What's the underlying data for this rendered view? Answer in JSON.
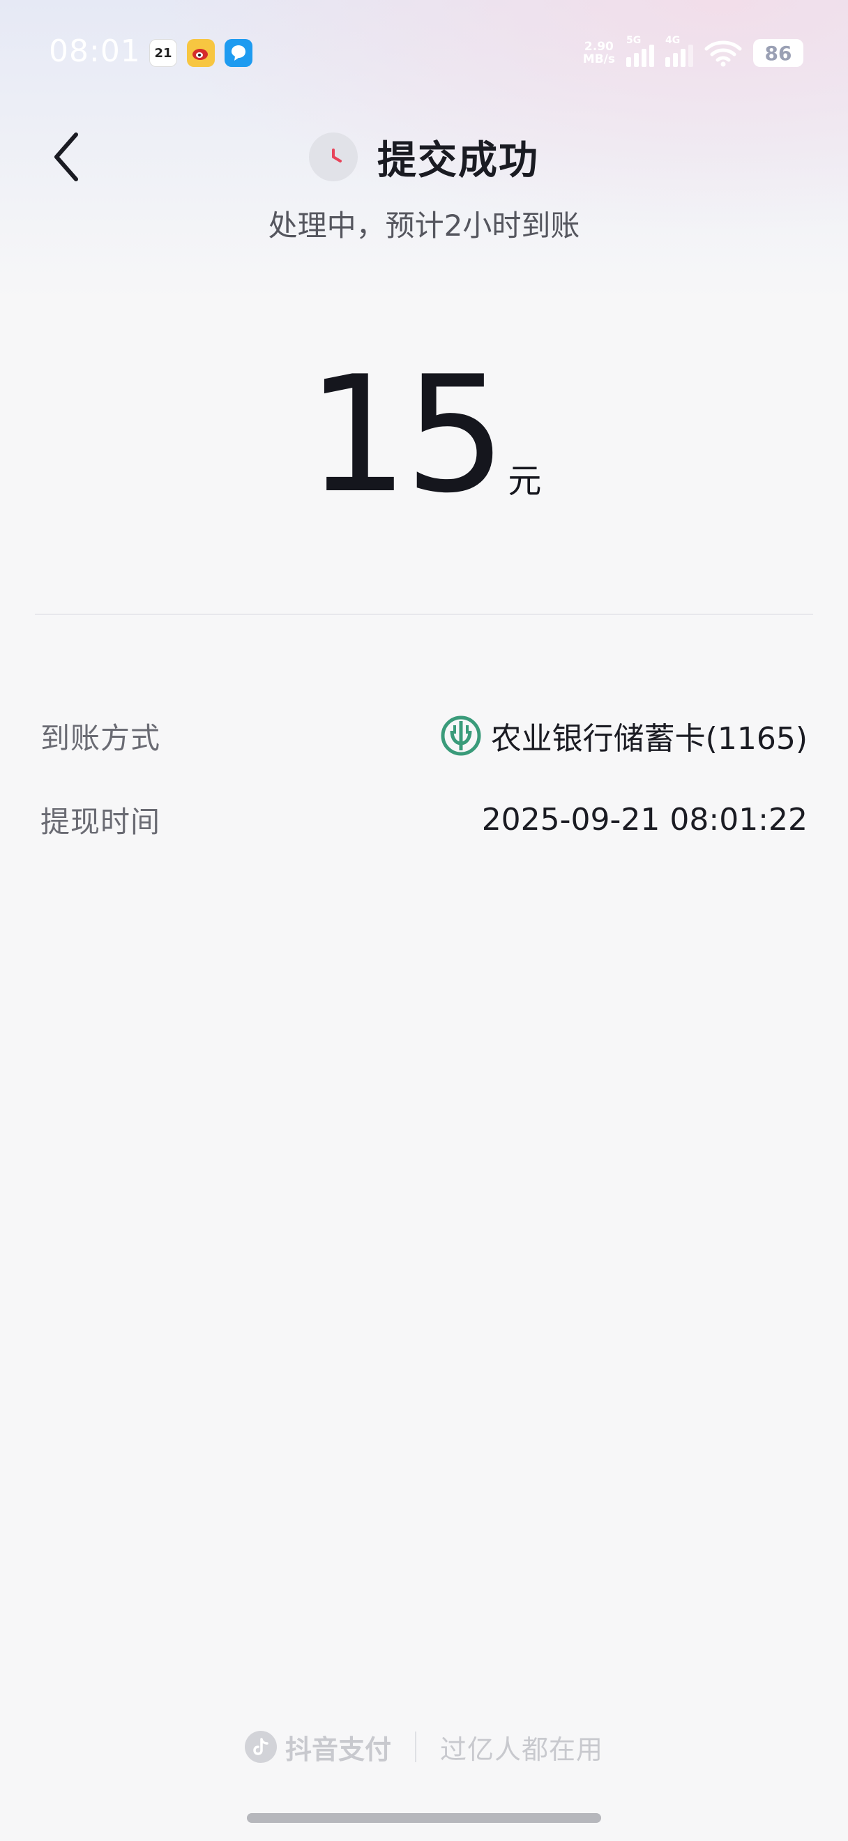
{
  "status_bar": {
    "time": "08:01",
    "calendar_day": "21",
    "net_speed_value": "2.90",
    "net_speed_unit": "MB/s",
    "signal_1_label": "5G",
    "signal_2_label": "4G",
    "battery": "86"
  },
  "header": {
    "title": "提交成功",
    "subtitle": "处理中，预计2小时到账"
  },
  "amount": {
    "value": "15",
    "unit": "元"
  },
  "details": [
    {
      "label": "到账方式",
      "value": "农业银行储蓄卡(1165)"
    },
    {
      "label": "提现时间",
      "value": "2025-09-21 08:01:22"
    }
  ],
  "footer": {
    "brand": "抖音支付",
    "slogan": "过亿人都在用"
  },
  "colors": {
    "accent_red": "#e8445a",
    "bank_green": "#3a9b7a",
    "text_primary": "#1a1b22",
    "text_secondary": "#6a6b73"
  }
}
